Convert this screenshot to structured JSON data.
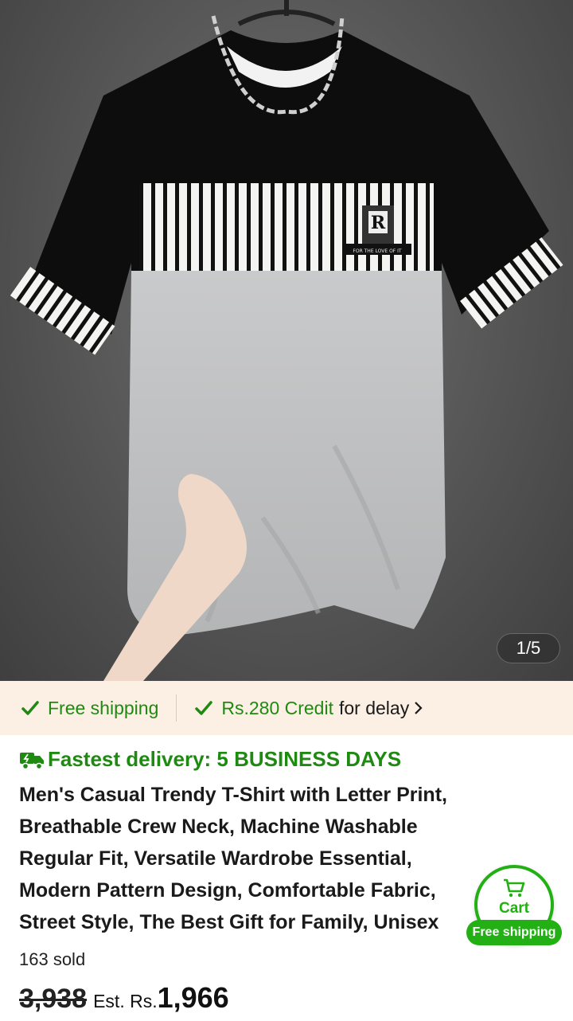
{
  "gallery": {
    "image_alt": "Men's black, white striped and grey colour-block T-shirt on a hanger",
    "print_logo_letter": "R",
    "print_tagline": "FOR THE LOVE OF IT",
    "counter": "1/5"
  },
  "shipping_bar": {
    "free_shipping": "Free shipping",
    "credit_amount": "Rs.280 Credit",
    "credit_suffix": "for delay",
    "check_icon": "check-icon",
    "chevron_icon": "chevron-right-icon",
    "accent_color": "#1f8a12",
    "background": "#fcefe3"
  },
  "delivery": {
    "icon": "delivery-truck-icon",
    "text": "Fastest delivery: 5 BUSINESS DAYS"
  },
  "product": {
    "title": "Men's Casual Trendy T-Shirt with Letter Print,\nBreathable Crew Neck, Machine Washable\nRegular Fit, Versatile Wardrobe Essential,\nModern Pattern Design, Comfortable Fabric,\nStreet Style, The Best Gift for Family, Unisex",
    "sold": "163 sold"
  },
  "price": {
    "original": "3,938",
    "estimated_prefix": "Est. Rs.",
    "estimated": "1,966"
  },
  "cart": {
    "icon": "cart-icon",
    "label": "Cart",
    "badge": "Free shipping",
    "accent_color": "#22b014"
  }
}
